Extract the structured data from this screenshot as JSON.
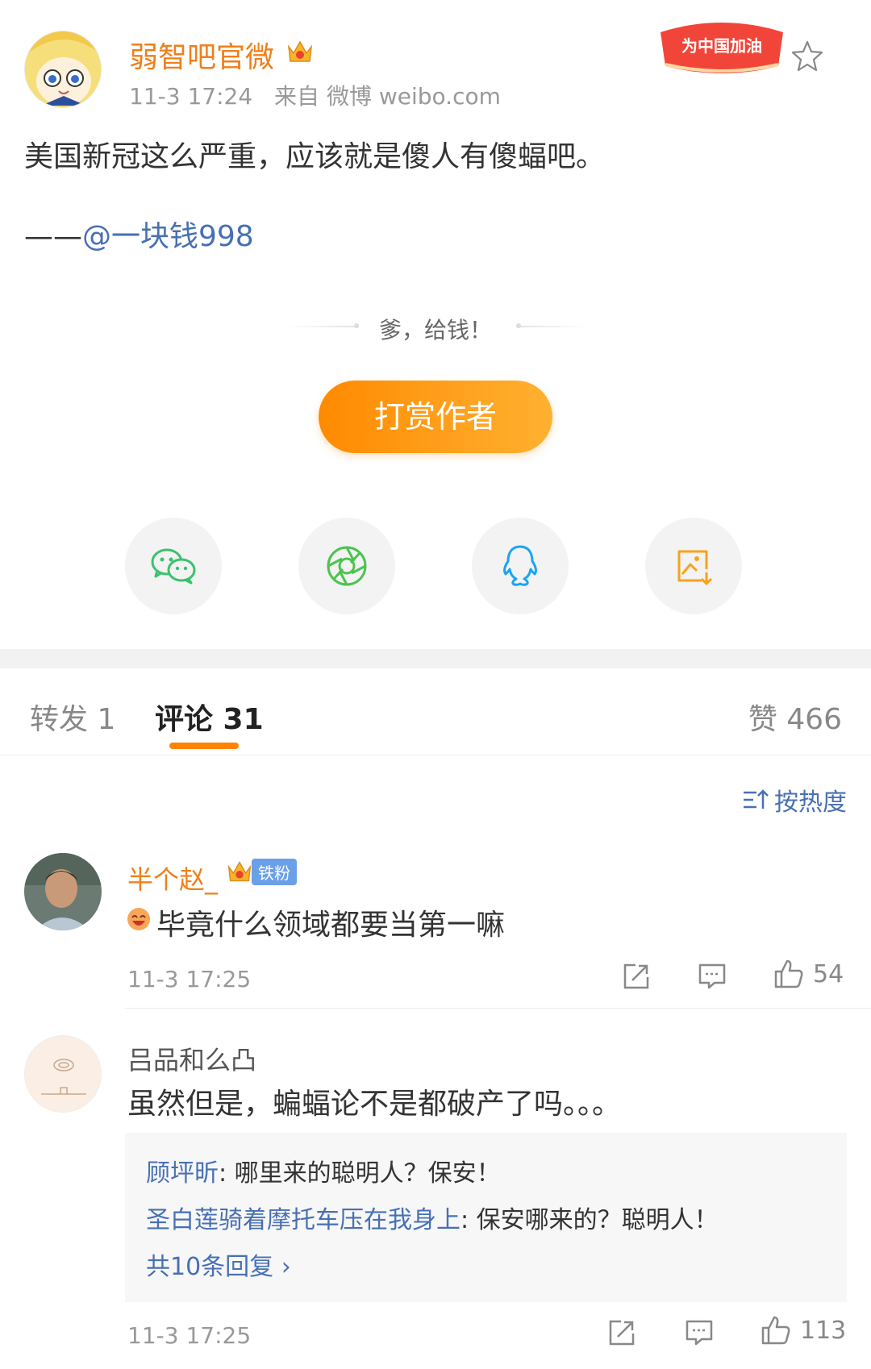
{
  "post": {
    "author": "弱智吧官微",
    "time": "11-3 17:24",
    "source": "来自 微博 weibo.com",
    "promo": "为中国加油",
    "text": "美国新冠这么严重，应该就是傻人有傻蝠吧。",
    "credit_prefix": "——",
    "credit_mention": "@一块钱998"
  },
  "reward": {
    "caption": "爹，给钱！",
    "button": "打赏作者"
  },
  "share": [
    {
      "icon": "wechat-icon"
    },
    {
      "icon": "moments-icon"
    },
    {
      "icon": "qq-icon"
    },
    {
      "icon": "save-image-icon"
    }
  ],
  "tabs": {
    "repost": "转发 1",
    "comment": "评论 31",
    "likes": "赞 466"
  },
  "sort": {
    "label": "按热度"
  },
  "comments": [
    {
      "user": "半个赵_",
      "badge": "铁粉",
      "text": "毕竟什么领域都要当第一嘛",
      "time": "11-3 17:25",
      "likes": "54"
    },
    {
      "user": "吕品和么凸",
      "text": "虽然但是，蝙蝠论不是都破产了吗。。。",
      "time": "11-3 17:25",
      "likes": "113",
      "replies": [
        {
          "user": "顾坪昕",
          "text": ": 哪里来的聪明人？保安！"
        },
        {
          "user": "圣白莲骑着摩托车压在我身上",
          "text": ": 保安哪来的？聪明人！"
        }
      ],
      "more_replies": "共10条回复 "
    }
  ],
  "colors": {
    "accent": "#ff8200",
    "link": "#4770b3",
    "username": "#f07f1a"
  }
}
